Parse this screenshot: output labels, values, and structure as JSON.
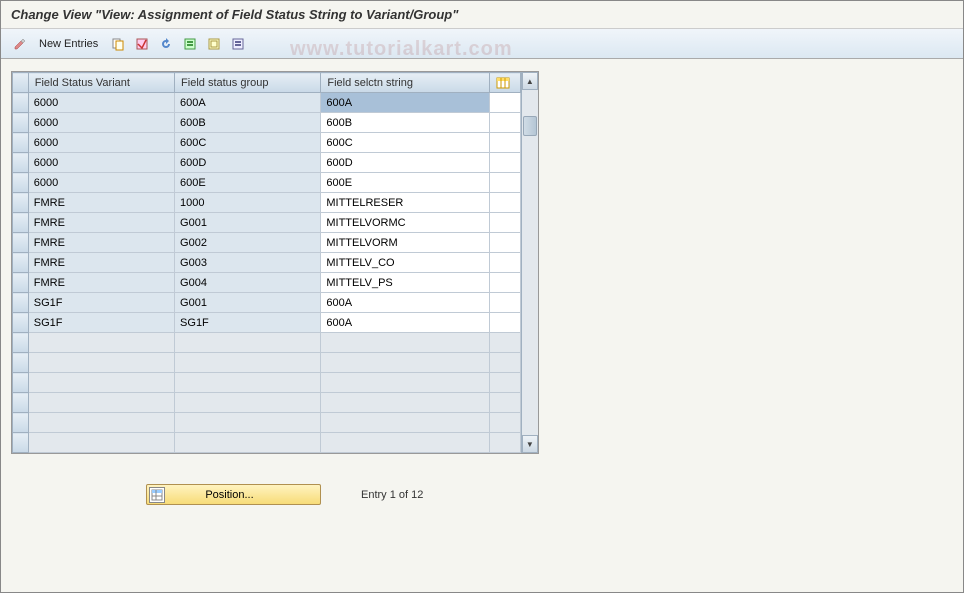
{
  "title": "Change View \"View: Assignment of Field Status String to Variant/Group\"",
  "toolbar": {
    "new_entries_label": "New Entries"
  },
  "watermark": "www.tutorialkart.com",
  "table": {
    "headers": {
      "variant": "Field Status Variant",
      "group": "Field status group",
      "string": "Field selctn string"
    },
    "rows": [
      {
        "variant": "6000",
        "group": "600A",
        "string": "600A",
        "readonly": true,
        "selected": true
      },
      {
        "variant": "6000",
        "group": "600B",
        "string": "600B",
        "readonly": true
      },
      {
        "variant": "6000",
        "group": "600C",
        "string": "600C",
        "readonly": true
      },
      {
        "variant": "6000",
        "group": "600D",
        "string": "600D",
        "readonly": true
      },
      {
        "variant": "6000",
        "group": "600E",
        "string": "600E",
        "readonly": true
      },
      {
        "variant": "FMRE",
        "group": "1000",
        "string": "MITTELRESER",
        "readonly": true
      },
      {
        "variant": "FMRE",
        "group": "G001",
        "string": "MITTELVORMC",
        "readonly": true
      },
      {
        "variant": "FMRE",
        "group": "G002",
        "string": "MITTELVORM",
        "readonly": true
      },
      {
        "variant": "FMRE",
        "group": "G003",
        "string": "MITTELV_CO",
        "readonly": true
      },
      {
        "variant": "FMRE",
        "group": "G004",
        "string": "MITTELV_PS",
        "readonly": true
      },
      {
        "variant": "SG1F",
        "group": "G001",
        "string": "600A",
        "readonly": true
      },
      {
        "variant": "SG1F",
        "group": "SG1F",
        "string": "600A",
        "readonly": true
      }
    ],
    "empty_rows": 6
  },
  "footer": {
    "position_label": "Position...",
    "entry_text": "Entry 1 of 12"
  }
}
